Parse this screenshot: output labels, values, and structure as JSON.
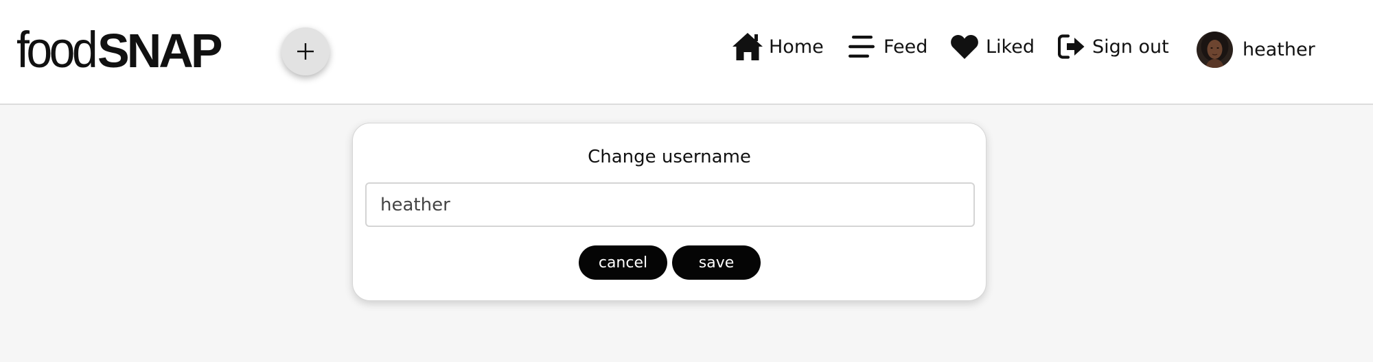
{
  "header": {
    "logo": {
      "light": "food",
      "bold": "SNAP"
    },
    "add_button": {
      "icon": "plus-icon",
      "symbol": "+"
    },
    "nav": [
      {
        "label": "Home",
        "icon": "home-icon"
      },
      {
        "label": "Feed",
        "icon": "menu-lines-icon"
      },
      {
        "label": "Liked",
        "icon": "heart-icon"
      },
      {
        "label": "Sign out",
        "icon": "sign-out-icon"
      }
    ],
    "profile": {
      "name": "heather",
      "avatar": "avatar-photo"
    }
  },
  "dialog": {
    "title": "Change username",
    "input_value": "heather",
    "cancel_label": "cancel",
    "save_label": "save"
  },
  "colors": {
    "page_background": "#f6f6f6",
    "header_background": "#ffffff",
    "button_background": "#050505",
    "button_text": "#ffffff",
    "add_button_background": "#e2e2e2"
  }
}
